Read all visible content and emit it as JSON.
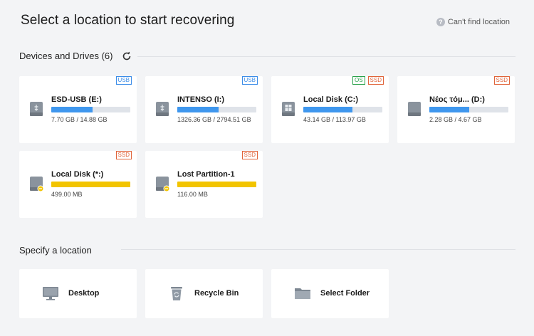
{
  "header": {
    "title": "Select a location to start recovering",
    "help_label": "Can't find location",
    "help_glyph": "?"
  },
  "devices": {
    "section_label": "Devices and Drives (6)",
    "drives": [
      {
        "name": "ESD-USB (E:)",
        "size": "7.70 GB / 14.88 GB",
        "used_fraction": 0.52,
        "badges": [
          "USB"
        ],
        "icon": "usb-drive-icon",
        "bar_color": "#3f97ee"
      },
      {
        "name": "INTENSO (I:)",
        "size": "1326.36 GB / 2794.51 GB",
        "used_fraction": 0.52,
        "badges": [
          "USB"
        ],
        "icon": "usb-drive-icon",
        "bar_color": "#3f97ee"
      },
      {
        "name": "Local Disk (C:)",
        "size": "43.14 GB / 113.97 GB",
        "used_fraction": 0.62,
        "badges": [
          "OS",
          "SSD"
        ],
        "icon": "windows-drive-icon",
        "bar_color": "#3f97ee"
      },
      {
        "name": "Νέος τόμ...  (D:)",
        "size": "2.28 GB / 4.67 GB",
        "used_fraction": 0.5,
        "badges": [
          "SSD"
        ],
        "icon": "hard-drive-icon",
        "bar_color": "#3f97ee"
      },
      {
        "name": "Local Disk (*:)",
        "size": "499.00 MB",
        "used_fraction": 1.0,
        "badges": [
          "SSD"
        ],
        "icon": "warning-drive-icon",
        "bar_color": "#f2c400"
      },
      {
        "name": "Lost Partition-1",
        "size": "116.00 MB",
        "used_fraction": 1.0,
        "badges": [
          "SSD"
        ],
        "icon": "warning-drive-icon",
        "bar_color": "#f2c400"
      }
    ]
  },
  "specify": {
    "section_label": "Specify a location",
    "locations": [
      {
        "label": "Desktop",
        "icon": "desktop-icon"
      },
      {
        "label": "Recycle Bin",
        "icon": "recycle-bin-icon"
      },
      {
        "label": "Select Folder",
        "icon": "folder-icon"
      }
    ]
  },
  "colors": {
    "background": "#f3f4f6",
    "accent_blue": "#3f97ee",
    "warning_yellow": "#f2c400",
    "usb_badge": "#3c8de8",
    "ssd_badge": "#e0643a",
    "os_badge": "#2ba24c"
  }
}
